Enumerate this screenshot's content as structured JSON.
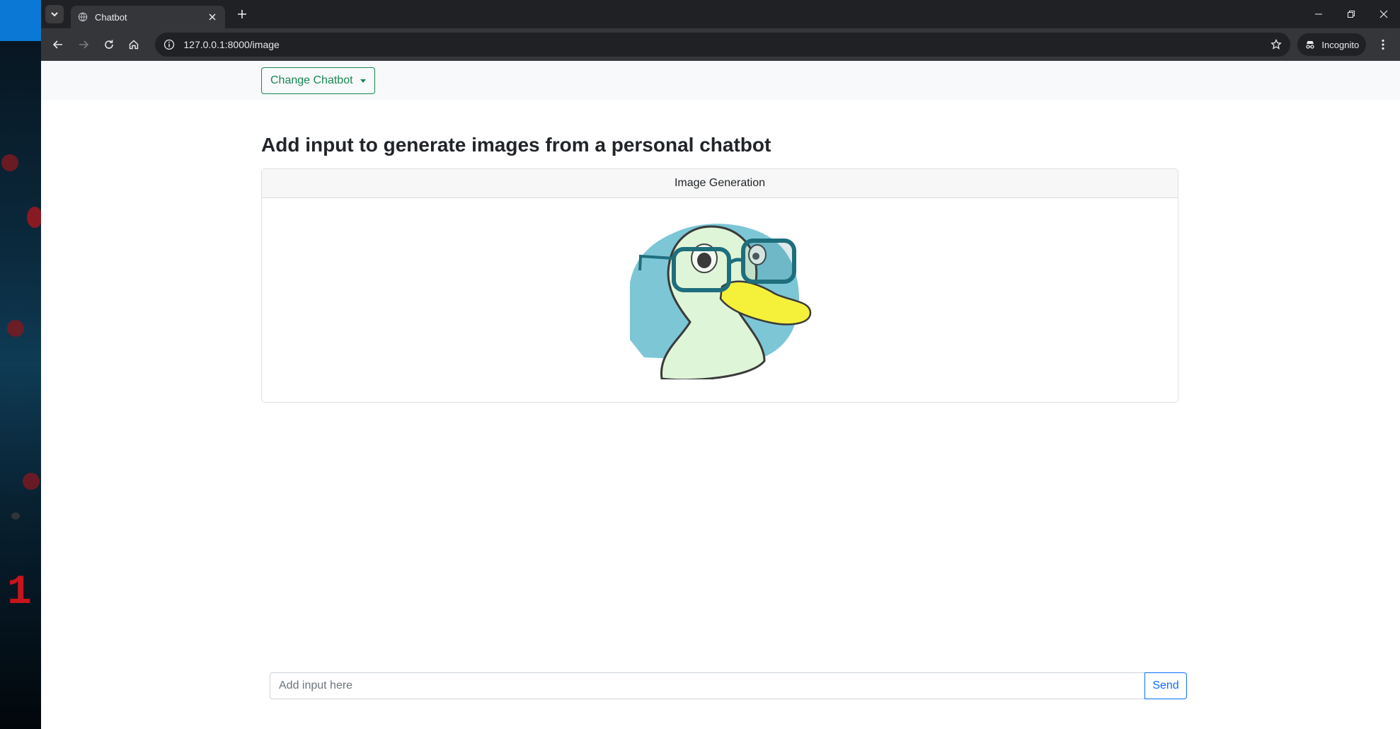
{
  "browser": {
    "tab_title": "Chatbot",
    "url": "127.0.0.1:8000/image",
    "profile_label": "Incognito"
  },
  "page": {
    "nav": {
      "dropdown_label": "Change Chatbot"
    },
    "heading": "Add input to generate images from a personal chatbot",
    "card": {
      "header": "Image Generation",
      "image_icon": "duck-with-glasses-illustration"
    },
    "input": {
      "placeholder": "Add input here",
      "value": ""
    },
    "send_label": "Send"
  },
  "colors": {
    "success": "#198754",
    "primary": "#0d6efd",
    "navbar_bg": "#f8f9fa",
    "chrome_dark": "#202124",
    "chrome_toolbar": "#35363a"
  }
}
